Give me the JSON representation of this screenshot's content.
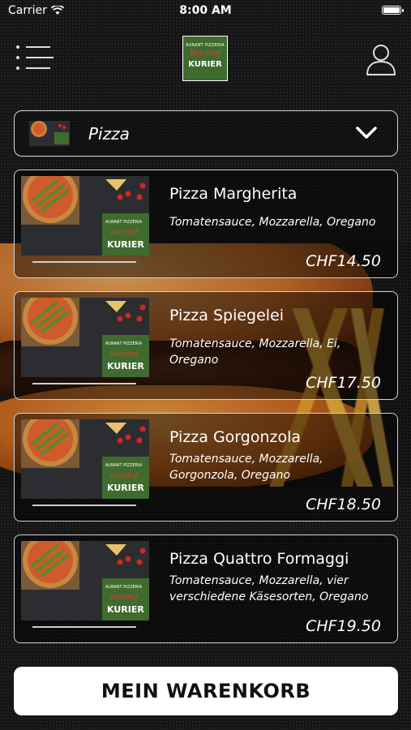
{
  "status_bar": {
    "carrier": "Carrier",
    "time": "8:00 AM"
  },
  "header": {
    "logo": {
      "top_text": "AURANT PIZZERIA",
      "script_text": "Bahnhof",
      "bottom_text": "KURIER"
    },
    "menu_icon": "menu-list-icon",
    "user_icon": "user-icon"
  },
  "category": {
    "label": "Pizza",
    "icon": "chevron-down-icon"
  },
  "products": [
    {
      "name": "Pizza Margherita",
      "description": "Tomatensauce, Mozzarella, Oregano",
      "price": "CHF14.50"
    },
    {
      "name": "Pizza Spiegelei",
      "description": "Tomatensauce, Mozzarella, Ei, Oregano",
      "price": "CHF17.50"
    },
    {
      "name": "Pizza Gorgonzola",
      "description": "Tomatensauce, Mozzarella, Gorgonzola, Oregano",
      "price": "CHF18.50"
    },
    {
      "name": "Pizza Quattro Formaggi",
      "description": "Tomatensauce, Mozzarella, vier verschiedene Käsesorten, Oregano",
      "price": "CHF19.50"
    }
  ],
  "cart_button": {
    "label": "MEIN WARENKORB"
  },
  "colors": {
    "background": "#151515",
    "logo_green": "#3f6b2e",
    "logo_script_red": "#e83a3a",
    "button": "#ffffff"
  }
}
